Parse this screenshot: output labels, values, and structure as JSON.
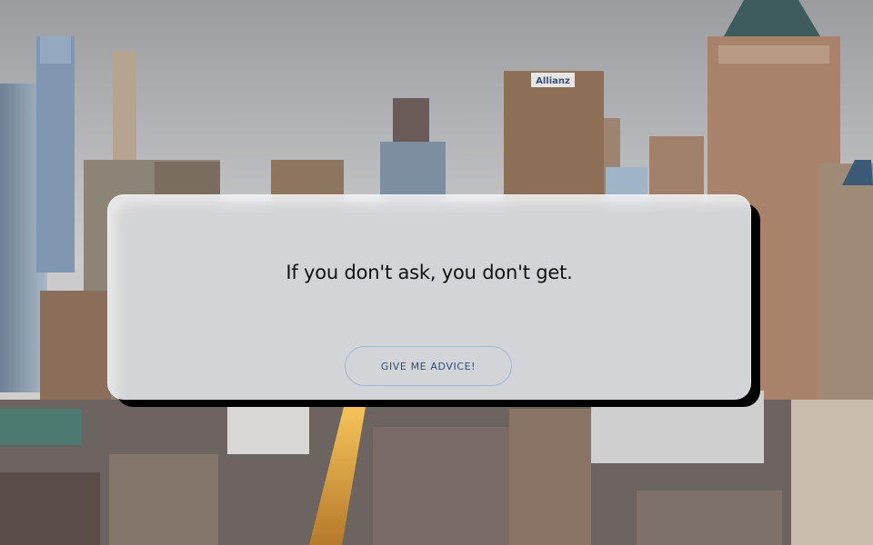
{
  "background": {
    "description_icon": "city-skyline-icon",
    "sign_text": "Allianz"
  },
  "card": {
    "quote": "If you don't ask, you don't get.",
    "button_label": "GIVE ME ADVICE!"
  },
  "colors": {
    "card_bg": "#f6f7fa",
    "shadow": "#000000",
    "button_border": "#9db7d6",
    "button_text": "#2c4f7a",
    "quote_text": "#111111"
  }
}
